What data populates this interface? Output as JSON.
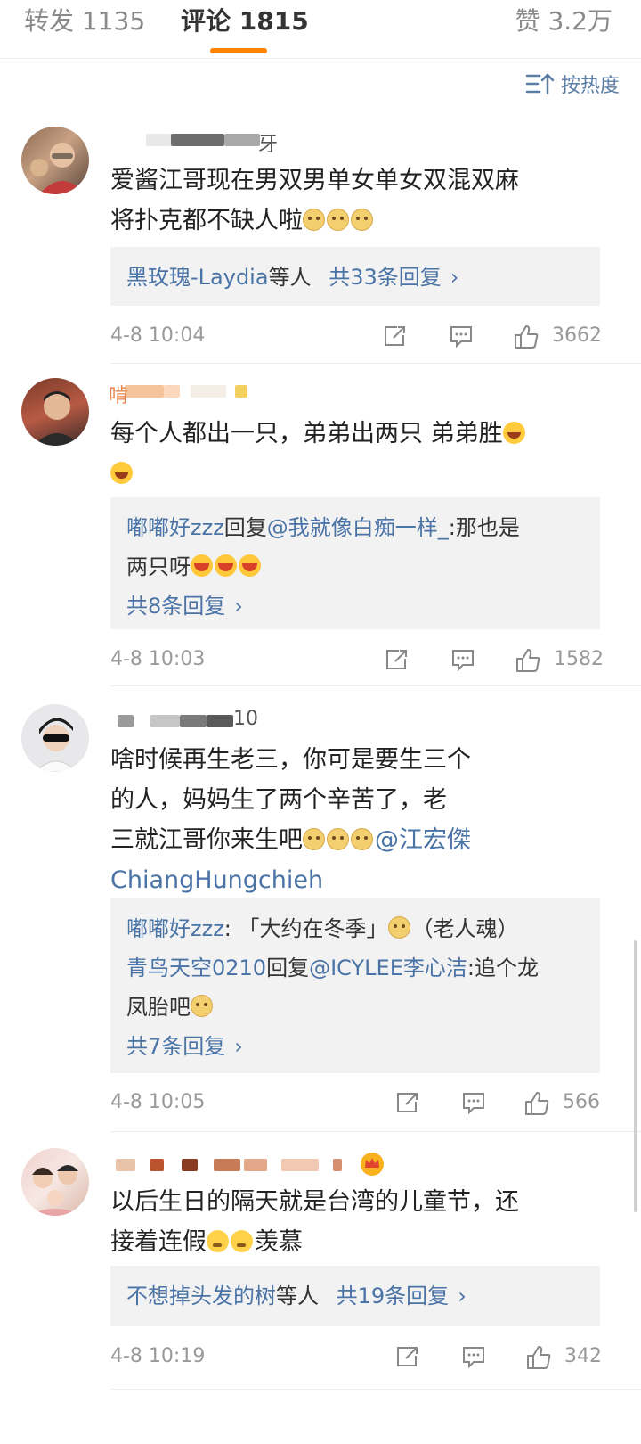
{
  "tabs": {
    "repost": "转发 1135",
    "comment": "评论 1815",
    "like": "赞 3.2万"
  },
  "sort": {
    "label": "按热度",
    "icon": "sort-icon"
  },
  "colors": {
    "accent": "#ff8200",
    "link": "#4a73a6",
    "meta": "#999999"
  },
  "comments": [
    {
      "name_tail": "牙",
      "text_1": "爱酱江哥现在男双男单女单女双混双麻",
      "text_2": "将扑克都不缺人啦",
      "reply_summary_name": "黑玫瑰-Laydia",
      "reply_summary_mid": "等人",
      "reply_summary_count": "共33条回复",
      "time": "4-8 10:04",
      "likes": "3662"
    },
    {
      "name_tail": "啃",
      "text_1": "每个人都出一只，弟弟出两只 弟弟胜",
      "reply_user": "嘟嘟好zzz",
      "reply_verb": "回复",
      "reply_target": "@我就像白痴一样_",
      "reply_text_1": ":那也是",
      "reply_text_2": "两只呀",
      "reply_count": "共8条回复",
      "time": "4-8 10:03",
      "likes": "1582"
    },
    {
      "name_tail": "10",
      "text_1": "啥时候再生老三，你可是要生三个",
      "text_2": "的人，妈妈生了两个辛苦了，老",
      "text_3": "三就江哥你来生吧",
      "mention": "@江宏傑",
      "text_4": "ChiangHungchieh",
      "reply_user_1": "嘟嘟好zzz",
      "reply_text_1": ": 「大约在冬季」",
      "reply_text_1b": "（老人魂）",
      "reply_user_2": "青鸟天空0210",
      "reply_verb": "回复",
      "reply_target": "@ICYLEE李心洁",
      "reply_text_2": ":追个龙",
      "reply_text_3": "凤胎吧",
      "reply_count": "共7条回复",
      "time": "4-8 10:05",
      "likes": "566"
    },
    {
      "text_1": "以后生日的隔天就是台湾的儿童节，还",
      "text_2": "接着连假",
      "text_2b": "羡慕",
      "reply_summary_name": "不想掉头发的树",
      "reply_summary_mid": "等人",
      "reply_summary_count": "共19条回复",
      "time": "4-8 10:19",
      "likes": "342"
    }
  ]
}
